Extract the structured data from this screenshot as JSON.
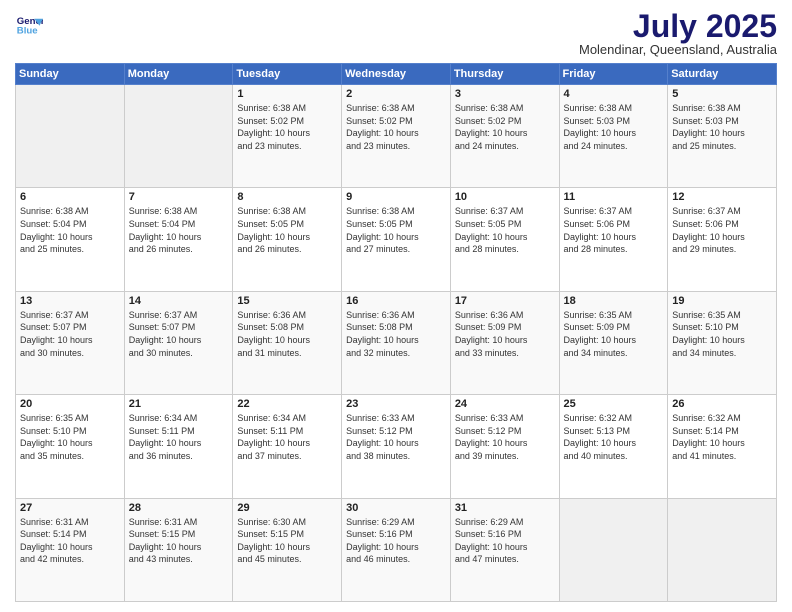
{
  "header": {
    "logo_line1": "General",
    "logo_line2": "Blue",
    "month": "July 2025",
    "location": "Molendinar, Queensland, Australia"
  },
  "days_of_week": [
    "Sunday",
    "Monday",
    "Tuesday",
    "Wednesday",
    "Thursday",
    "Friday",
    "Saturday"
  ],
  "weeks": [
    [
      {
        "day": "",
        "content": ""
      },
      {
        "day": "",
        "content": ""
      },
      {
        "day": "1",
        "content": "Sunrise: 6:38 AM\nSunset: 5:02 PM\nDaylight: 10 hours\nand 23 minutes."
      },
      {
        "day": "2",
        "content": "Sunrise: 6:38 AM\nSunset: 5:02 PM\nDaylight: 10 hours\nand 23 minutes."
      },
      {
        "day": "3",
        "content": "Sunrise: 6:38 AM\nSunset: 5:02 PM\nDaylight: 10 hours\nand 24 minutes."
      },
      {
        "day": "4",
        "content": "Sunrise: 6:38 AM\nSunset: 5:03 PM\nDaylight: 10 hours\nand 24 minutes."
      },
      {
        "day": "5",
        "content": "Sunrise: 6:38 AM\nSunset: 5:03 PM\nDaylight: 10 hours\nand 25 minutes."
      }
    ],
    [
      {
        "day": "6",
        "content": "Sunrise: 6:38 AM\nSunset: 5:04 PM\nDaylight: 10 hours\nand 25 minutes."
      },
      {
        "day": "7",
        "content": "Sunrise: 6:38 AM\nSunset: 5:04 PM\nDaylight: 10 hours\nand 26 minutes."
      },
      {
        "day": "8",
        "content": "Sunrise: 6:38 AM\nSunset: 5:05 PM\nDaylight: 10 hours\nand 26 minutes."
      },
      {
        "day": "9",
        "content": "Sunrise: 6:38 AM\nSunset: 5:05 PM\nDaylight: 10 hours\nand 27 minutes."
      },
      {
        "day": "10",
        "content": "Sunrise: 6:37 AM\nSunset: 5:05 PM\nDaylight: 10 hours\nand 28 minutes."
      },
      {
        "day": "11",
        "content": "Sunrise: 6:37 AM\nSunset: 5:06 PM\nDaylight: 10 hours\nand 28 minutes."
      },
      {
        "day": "12",
        "content": "Sunrise: 6:37 AM\nSunset: 5:06 PM\nDaylight: 10 hours\nand 29 minutes."
      }
    ],
    [
      {
        "day": "13",
        "content": "Sunrise: 6:37 AM\nSunset: 5:07 PM\nDaylight: 10 hours\nand 30 minutes."
      },
      {
        "day": "14",
        "content": "Sunrise: 6:37 AM\nSunset: 5:07 PM\nDaylight: 10 hours\nand 30 minutes."
      },
      {
        "day": "15",
        "content": "Sunrise: 6:36 AM\nSunset: 5:08 PM\nDaylight: 10 hours\nand 31 minutes."
      },
      {
        "day": "16",
        "content": "Sunrise: 6:36 AM\nSunset: 5:08 PM\nDaylight: 10 hours\nand 32 minutes."
      },
      {
        "day": "17",
        "content": "Sunrise: 6:36 AM\nSunset: 5:09 PM\nDaylight: 10 hours\nand 33 minutes."
      },
      {
        "day": "18",
        "content": "Sunrise: 6:35 AM\nSunset: 5:09 PM\nDaylight: 10 hours\nand 34 minutes."
      },
      {
        "day": "19",
        "content": "Sunrise: 6:35 AM\nSunset: 5:10 PM\nDaylight: 10 hours\nand 34 minutes."
      }
    ],
    [
      {
        "day": "20",
        "content": "Sunrise: 6:35 AM\nSunset: 5:10 PM\nDaylight: 10 hours\nand 35 minutes."
      },
      {
        "day": "21",
        "content": "Sunrise: 6:34 AM\nSunset: 5:11 PM\nDaylight: 10 hours\nand 36 minutes."
      },
      {
        "day": "22",
        "content": "Sunrise: 6:34 AM\nSunset: 5:11 PM\nDaylight: 10 hours\nand 37 minutes."
      },
      {
        "day": "23",
        "content": "Sunrise: 6:33 AM\nSunset: 5:12 PM\nDaylight: 10 hours\nand 38 minutes."
      },
      {
        "day": "24",
        "content": "Sunrise: 6:33 AM\nSunset: 5:12 PM\nDaylight: 10 hours\nand 39 minutes."
      },
      {
        "day": "25",
        "content": "Sunrise: 6:32 AM\nSunset: 5:13 PM\nDaylight: 10 hours\nand 40 minutes."
      },
      {
        "day": "26",
        "content": "Sunrise: 6:32 AM\nSunset: 5:14 PM\nDaylight: 10 hours\nand 41 minutes."
      }
    ],
    [
      {
        "day": "27",
        "content": "Sunrise: 6:31 AM\nSunset: 5:14 PM\nDaylight: 10 hours\nand 42 minutes."
      },
      {
        "day": "28",
        "content": "Sunrise: 6:31 AM\nSunset: 5:15 PM\nDaylight: 10 hours\nand 43 minutes."
      },
      {
        "day": "29",
        "content": "Sunrise: 6:30 AM\nSunset: 5:15 PM\nDaylight: 10 hours\nand 45 minutes."
      },
      {
        "day": "30",
        "content": "Sunrise: 6:29 AM\nSunset: 5:16 PM\nDaylight: 10 hours\nand 46 minutes."
      },
      {
        "day": "31",
        "content": "Sunrise: 6:29 AM\nSunset: 5:16 PM\nDaylight: 10 hours\nand 47 minutes."
      },
      {
        "day": "",
        "content": ""
      },
      {
        "day": "",
        "content": ""
      }
    ]
  ]
}
